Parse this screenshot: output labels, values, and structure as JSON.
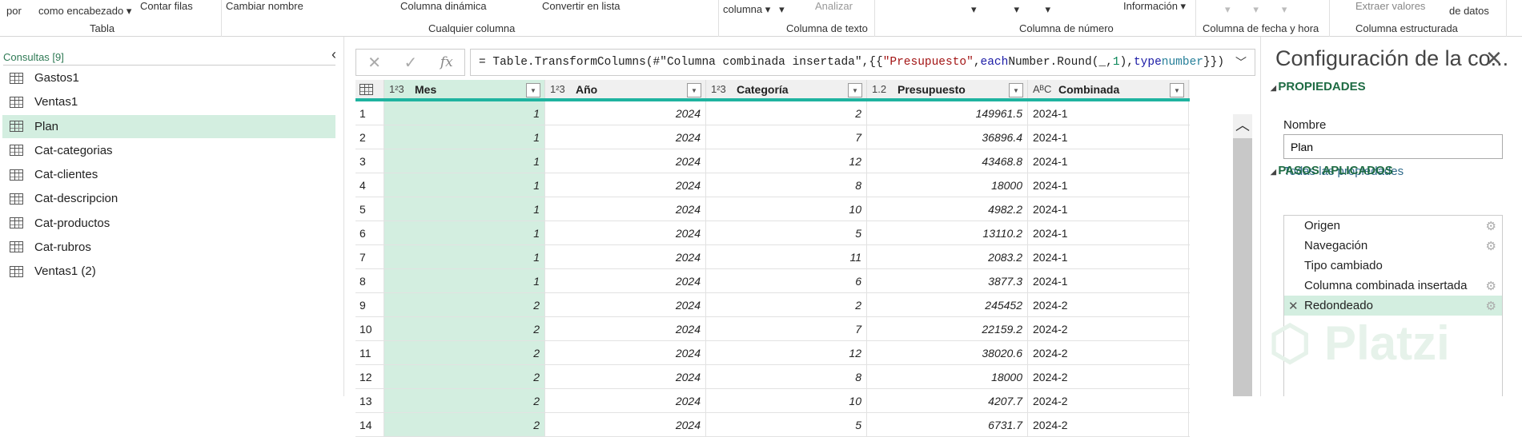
{
  "ribbon": {
    "items": [
      "por",
      "como encabezado",
      "Contar filas",
      "Cambiar nombre",
      "Columna dinámica",
      "Convertir en lista",
      "columna",
      "Analizar",
      "Información",
      "Extraer valores",
      "de datos"
    ],
    "groups": [
      "Tabla",
      "Cualquier columna",
      "Columna de texto",
      "Columna de número",
      "Columna de fecha y hora",
      "Columna estructurada"
    ]
  },
  "queries": {
    "header": "Consultas [9]",
    "items": [
      "Gastos1",
      "Ventas1",
      "Plan",
      "Cat-categorias",
      "Cat-clientes",
      "Cat-descripcion",
      "Cat-productos",
      "Cat-rubros",
      "Ventas1 (2)"
    ],
    "selected": "Plan"
  },
  "formula": {
    "prefix": "= Table.TransformColumns(#\"Columna combinada insertada\",{{",
    "s1": "\"Presupuesto\"",
    "p2": ", ",
    "k1": "each",
    "p3": " Number.Round(_, ",
    "n1": "1",
    "p4": "), ",
    "k2": "type",
    "p5": " ",
    "k3": "number",
    "p6": "}})",
    "fx": "fx"
  },
  "table": {
    "columns": [
      {
        "type": "1²3",
        "name": "Mes"
      },
      {
        "type": "1²3",
        "name": "Año"
      },
      {
        "type": "1²3",
        "name": "Categoría"
      },
      {
        "type": "1.2",
        "name": "Presupuesto"
      },
      {
        "type": "AᴮC",
        "name": "Combinada"
      }
    ],
    "rows": [
      [
        "1",
        "1",
        "2024",
        "2",
        "149961.5",
        "2024-1"
      ],
      [
        "2",
        "1",
        "2024",
        "7",
        "36896.4",
        "2024-1"
      ],
      [
        "3",
        "1",
        "2024",
        "12",
        "43468.8",
        "2024-1"
      ],
      [
        "4",
        "1",
        "2024",
        "8",
        "18000",
        "2024-1"
      ],
      [
        "5",
        "1",
        "2024",
        "10",
        "4982.2",
        "2024-1"
      ],
      [
        "6",
        "1",
        "2024",
        "5",
        "13110.2",
        "2024-1"
      ],
      [
        "7",
        "1",
        "2024",
        "11",
        "2083.2",
        "2024-1"
      ],
      [
        "8",
        "1",
        "2024",
        "6",
        "3877.3",
        "2024-1"
      ],
      [
        "9",
        "2",
        "2024",
        "2",
        "245452",
        "2024-2"
      ],
      [
        "10",
        "2",
        "2024",
        "7",
        "22159.2",
        "2024-2"
      ],
      [
        "11",
        "2",
        "2024",
        "12",
        "38020.6",
        "2024-2"
      ],
      [
        "12",
        "2",
        "2024",
        "8",
        "18000",
        "2024-2"
      ],
      [
        "13",
        "2",
        "2024",
        "10",
        "4207.7",
        "2024-2"
      ],
      [
        "14",
        "2",
        "2024",
        "5",
        "6731.7",
        "2024-2"
      ]
    ]
  },
  "settings": {
    "title": "Configuración de la co...",
    "properties": "PROPIEDADES",
    "name_label": "Nombre",
    "name_value": "Plan",
    "all_props": "Todas las propiedades",
    "steps_header": "PASOS APLICADOS",
    "steps": [
      {
        "label": "Origen",
        "gear": true
      },
      {
        "label": "Navegación",
        "gear": true
      },
      {
        "label": "Tipo cambiado",
        "gear": false
      },
      {
        "label": "Columna combinada insertada",
        "gear": true
      },
      {
        "label": "Redondeado",
        "gear": true
      }
    ],
    "selected_step": "Redondeado"
  },
  "watermark": "Platzi"
}
